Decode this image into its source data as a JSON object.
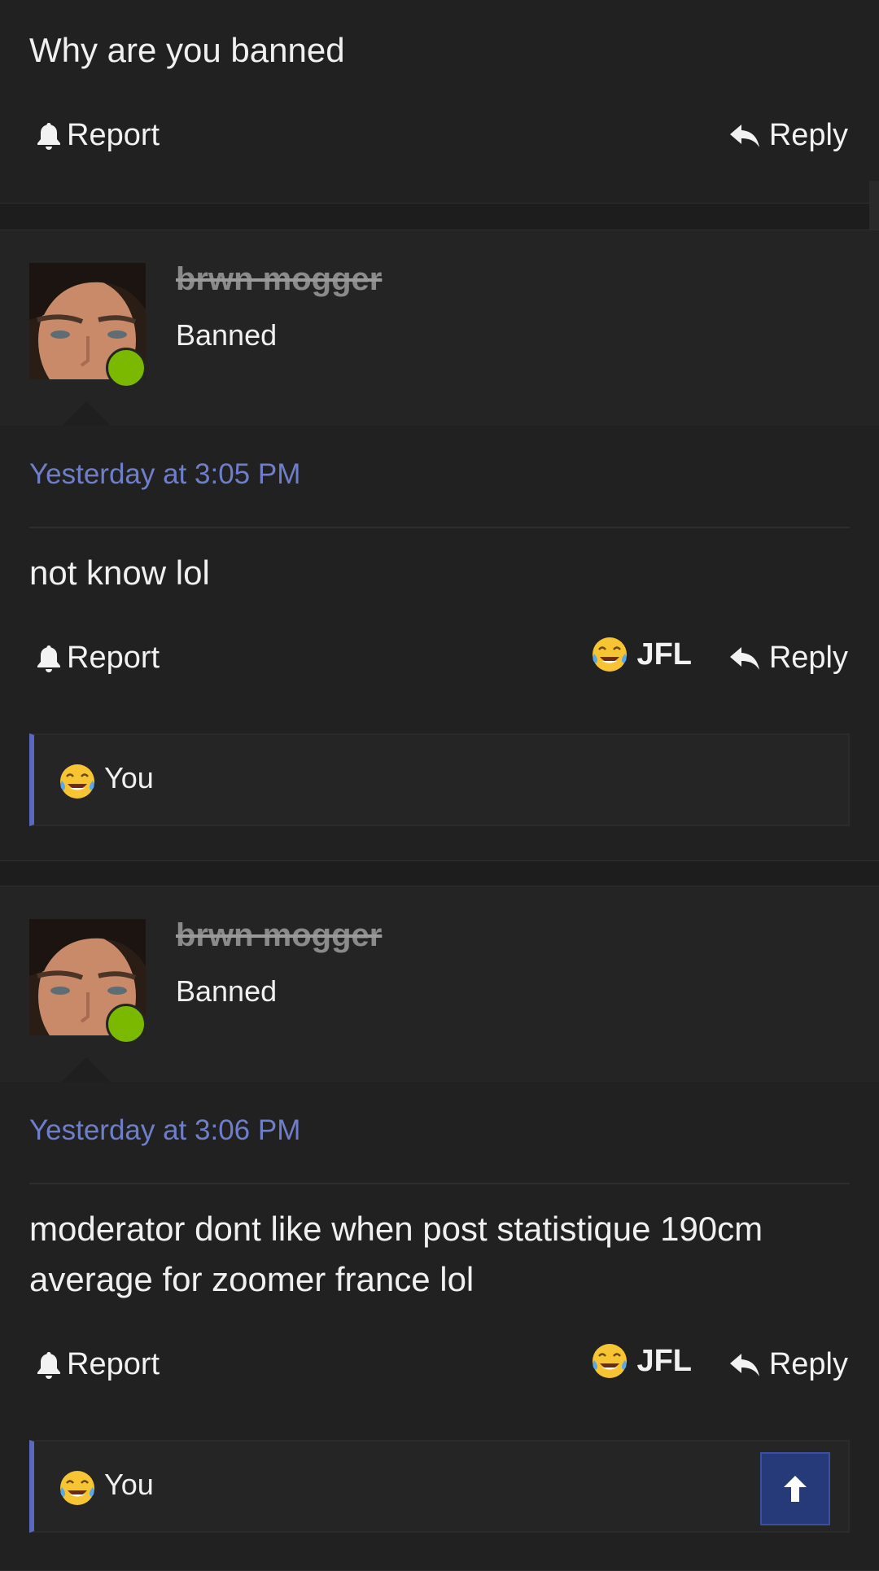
{
  "posts": [
    {
      "message": "Why are you banned",
      "report_label": "Report",
      "reply_label": "Reply"
    },
    {
      "username": "brwn mogger",
      "user_title": "Banned",
      "timestamp": "Yesterday at 3:05 PM",
      "message": "not know lol",
      "report_label": "Report",
      "reaction_label": "JFL",
      "reply_label": "Reply",
      "reactors": "You"
    },
    {
      "username": "brwn mogger",
      "user_title": "Banned",
      "timestamp": "Yesterday at 3:06 PM",
      "message": "moderator dont like when post statistique 190cm average for zoomer france lol",
      "report_label": "Report",
      "reaction_label": "JFL",
      "reply_label": "Reply",
      "reactors": "You"
    }
  ],
  "icons": {
    "report": "bell-icon",
    "reply": "reply-arrow-icon",
    "reaction": "tears-of-joy-emoji-icon",
    "back_to_top": "arrow-up-icon"
  },
  "colors": {
    "background": "#1d1d1d",
    "timestamp": "#6f7ec9",
    "online": "#7bb800",
    "reaction_accent": "#5b68c0",
    "back_to_top": "#263a7a"
  }
}
